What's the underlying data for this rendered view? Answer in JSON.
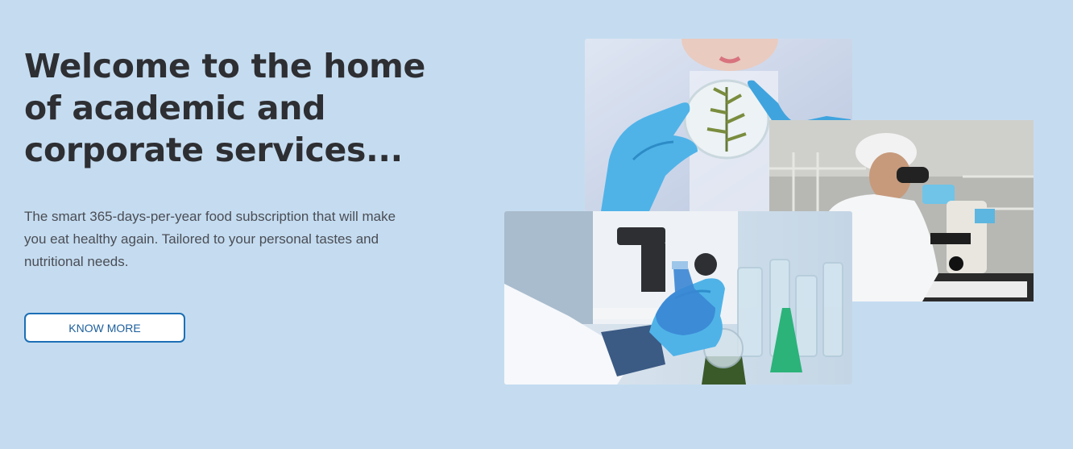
{
  "hero": {
    "headline": "Welcome to the home of academic and corporate services...",
    "lead": "The smart 365-days-per-year food subscription that will make you eat healthy again. Tailored to your personal tastes and nutritional needs.",
    "cta_label": "KNOW MORE"
  },
  "colors": {
    "background": "#c5dcf0",
    "heading": "#2e2f33",
    "body_text": "#4a4d55",
    "cta_border": "#1d6fb5",
    "glove": "#4fb3e8"
  }
}
